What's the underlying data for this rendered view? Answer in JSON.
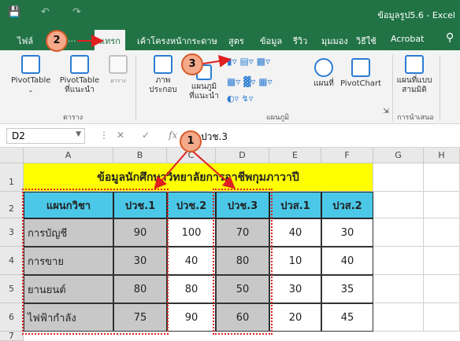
{
  "title_bar": {
    "doc_title": "ข้อมูลรูป5.6 - Excel",
    "save_icon": "save-icon",
    "undo_icon": "undo-icon",
    "redo_icon": "redo-icon"
  },
  "tabs": [
    {
      "label": "ไฟล์"
    },
    {
      "label": "ไฟล์"
    },
    {
      "label": "แทรก",
      "active": true
    },
    {
      "label": "เค้าโครงหน้ากระดาษ"
    },
    {
      "label": "สูตร"
    },
    {
      "label": "ข้อมูล"
    },
    {
      "label": "รีวิว"
    },
    {
      "label": "มุมมอง"
    },
    {
      "label": "วิธีใช้"
    },
    {
      "label": "Acrobat"
    }
  ],
  "ribbon": {
    "pivottable": "PivotTable",
    "recommended_pivot_line1": "PivotTable",
    "recommended_pivot_line2": "ที่แนะนำ",
    "table": "ตาราง",
    "tables_group": "ตาราง",
    "illustrations_line1": "ภาพ",
    "illustrations_line2": "ประกอบ",
    "recommended_charts_line1": "แผนภูมิ",
    "recommended_charts_line2": "ที่แนะนำ",
    "charts_group": "แผนภูมิ",
    "maps": "แผนที่",
    "pivotchart": "PivotChart",
    "map3d_line1": "แผนที่แบบ",
    "map3d_line2": "สามมิติ",
    "tours_group": "การนำเสนอ"
  },
  "formula_bar": {
    "namebox": "D2",
    "formula": "ปวช.3"
  },
  "columns": [
    "A",
    "B",
    "C",
    "D",
    "E",
    "F",
    "G",
    "H"
  ],
  "rows": [
    "1",
    "2",
    "3",
    "4",
    "5",
    "6",
    "7"
  ],
  "sheet": {
    "title": "ข้อมูลนักศึกษาวิทยาลัยการอาชีพกุมภาวาปี",
    "headers": [
      "แผนกวิชา",
      "ปวช.1",
      "ปวช.2",
      "ปวช.3",
      "ปวส.1",
      "ปวส.2"
    ],
    "data": [
      [
        "การบัญชี",
        "90",
        "100",
        "70",
        "40",
        "30"
      ],
      [
        "การขาย",
        "30",
        "40",
        "80",
        "10",
        "40"
      ],
      [
        "ยานยนต์",
        "80",
        "80",
        "50",
        "30",
        "35"
      ],
      [
        "ไฟฟ้ากำลัง",
        "75",
        "90",
        "60",
        "20",
        "45"
      ]
    ]
  },
  "callouts": {
    "c1": "1",
    "c2": "2",
    "c3": "3"
  },
  "colors": {
    "excel_green": "#217346",
    "title_yellow": "#ffff00",
    "header_cyan": "#4bc8e8",
    "selection_grey": "#c8c8c8",
    "callout_fill": "#f4a98a",
    "dotted_red": "#e02020"
  }
}
